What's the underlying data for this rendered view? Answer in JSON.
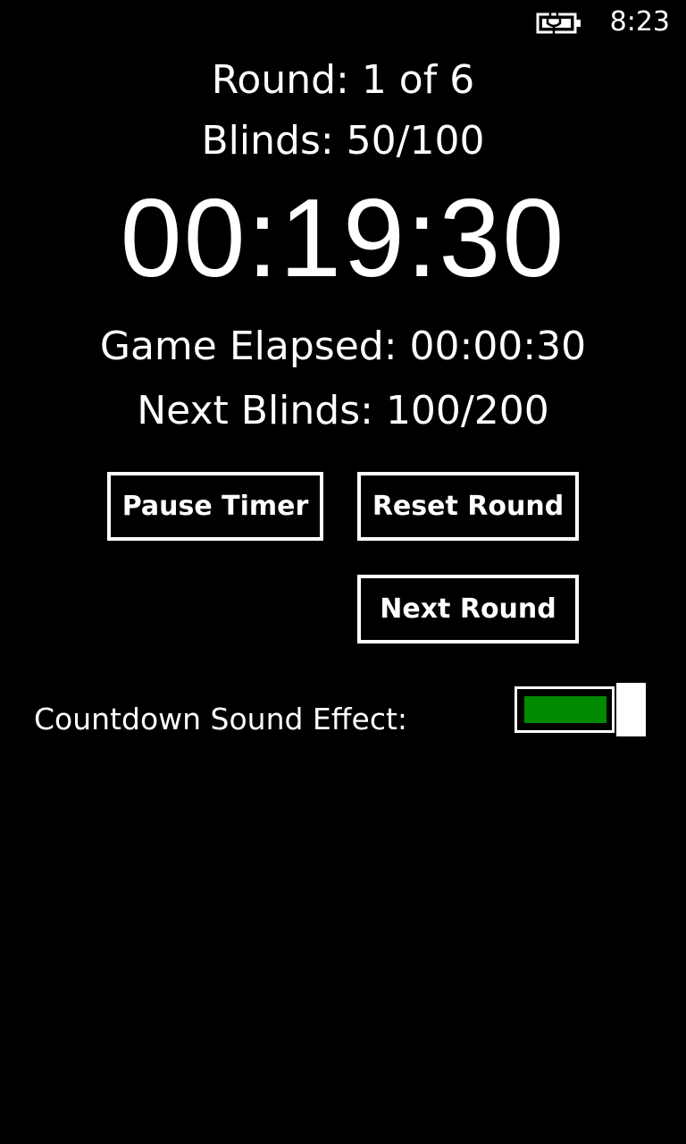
{
  "status_bar": {
    "battery_icon": "battery-charging-icon",
    "time": "8:23"
  },
  "game": {
    "round_text": "Round: 1 of 6",
    "blinds_text": "Blinds: 50/100",
    "timer": "00:19:30",
    "elapsed_text": "Game Elapsed: 00:00:30",
    "next_blinds_text": "Next Blinds: 100/200"
  },
  "buttons": {
    "pause_label": "Pause Timer",
    "reset_label": "Reset Round",
    "next_label": "Next Round"
  },
  "settings": {
    "sound_label": "Countdown Sound Effect:",
    "sound_on": true
  },
  "colors": {
    "background": "#000000",
    "foreground": "#ffffff",
    "toggle_accent": "#008a00"
  }
}
